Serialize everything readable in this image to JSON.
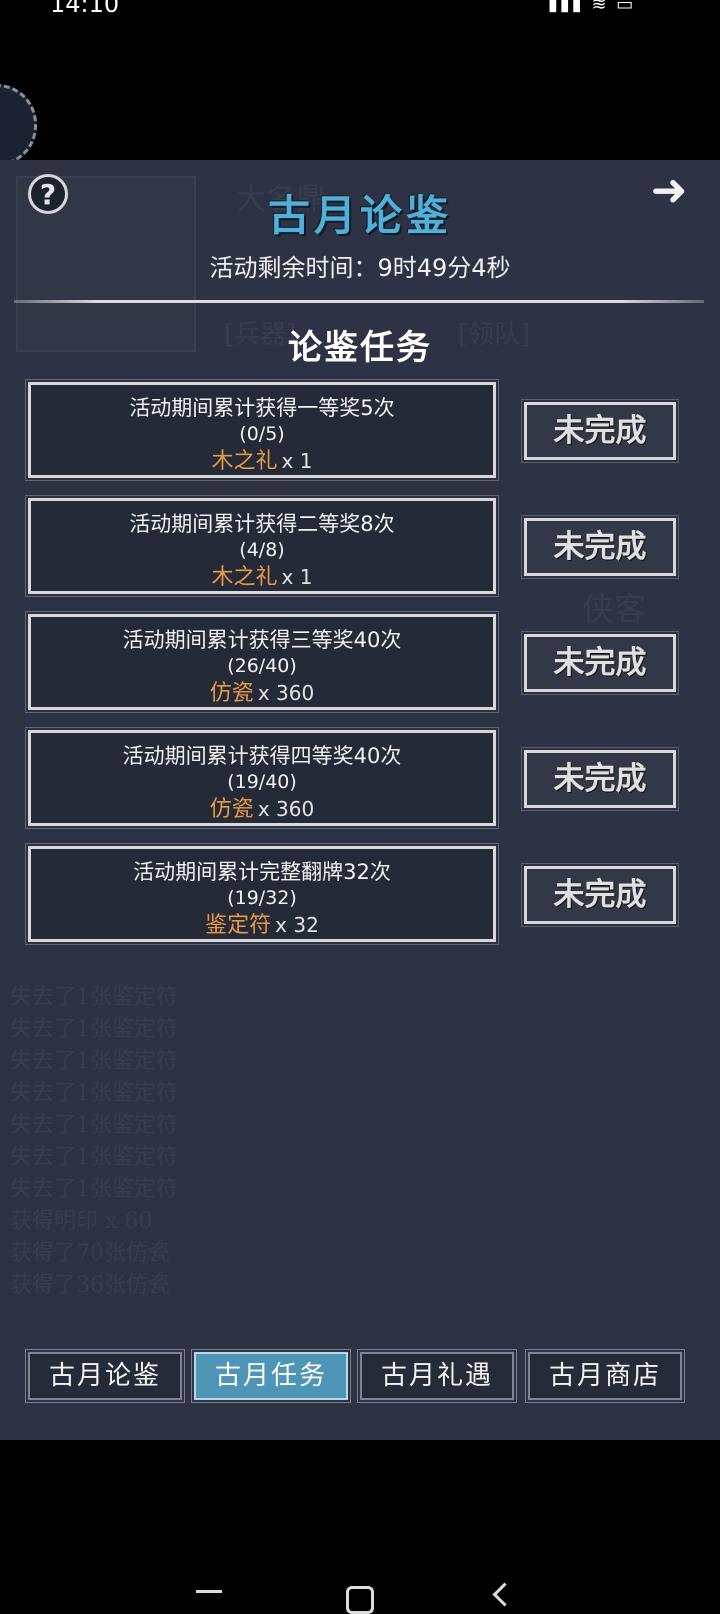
{
  "status_bar": {
    "time": "14:10",
    "icons": "▮▮▮ ≋ ▭"
  },
  "header": {
    "title": "古月论鉴",
    "remaining_label": "活动剩余时间：9时49分4秒",
    "help_label": "?",
    "next_label": "➜"
  },
  "section_title": "论鉴任务",
  "tasks": [
    {
      "desc": "活动期间累计获得一等奖5次",
      "progress": "(0/5)",
      "reward_name": "木之礼",
      "reward_qty": "x 1",
      "status": "未完成"
    },
    {
      "desc": "活动期间累计获得二等奖8次",
      "progress": "(4/8)",
      "reward_name": "木之礼",
      "reward_qty": "x 1",
      "status": "未完成"
    },
    {
      "desc": "活动期间累计获得三等奖40次",
      "progress": "(26/40)",
      "reward_name": "仿瓷",
      "reward_qty": "x 360",
      "status": "未完成"
    },
    {
      "desc": "活动期间累计获得四等奖40次",
      "progress": "(19/40)",
      "reward_name": "仿瓷",
      "reward_qty": "x 360",
      "status": "未完成"
    },
    {
      "desc": "活动期间累计完整翻牌32次",
      "progress": "(19/32)",
      "reward_name": "鉴定符",
      "reward_qty": "x 32",
      "status": "未完成"
    }
  ],
  "tabs": [
    {
      "label": "古月论鉴",
      "active": false
    },
    {
      "label": "古月任务",
      "active": true
    },
    {
      "label": "古月礼遇",
      "active": false
    },
    {
      "label": "古月商店",
      "active": false
    }
  ],
  "colors": {
    "panel": "#2d3344",
    "title": "#4fb0d8",
    "reward": "#e79a44",
    "tab_active": "#4f95b8"
  },
  "icons": [
    "help-icon",
    "arrow-right-icon"
  ]
}
